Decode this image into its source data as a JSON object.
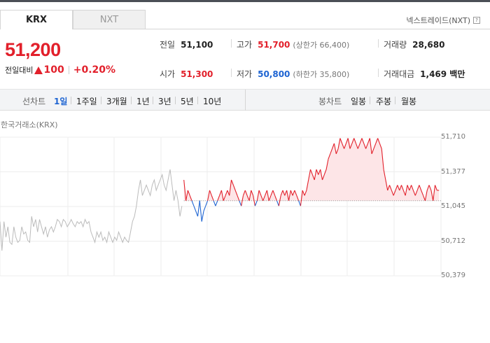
{
  "tabs": [
    {
      "label": "KRX",
      "active": true
    },
    {
      "label": "NXT",
      "active": false
    }
  ],
  "nxt_link": {
    "label": "넥스트레이드(NXT)",
    "icon": "question-icon"
  },
  "price": {
    "current": "51,200",
    "change_label": "전일대비",
    "change_value": "100",
    "change_percent": "+0.20%",
    "direction": "up",
    "up_color": "#e2202b",
    "down_color": "#1e64d2"
  },
  "stats": {
    "prev_close": {
      "label": "전일",
      "value": "51,100"
    },
    "high": {
      "label": "고가",
      "value": "51,700",
      "limit": "(상한가 66,400)"
    },
    "volume": {
      "label": "거래량",
      "value": "28,680"
    },
    "open": {
      "label": "시가",
      "value": "51,300"
    },
    "low": {
      "label": "저가",
      "value": "50,800",
      "limit": "(하한가 35,800)"
    },
    "amount": {
      "label": "거래대금",
      "value": "1,469 백만"
    }
  },
  "toolbar": {
    "line_label": "선차트",
    "line_periods": [
      "1일",
      "1주일",
      "3개월",
      "1년",
      "3년",
      "5년",
      "10년"
    ],
    "line_active": "1일",
    "candle_label": "봉차트",
    "candle_periods": [
      "일봉",
      "주봉",
      "월봉"
    ]
  },
  "chart_title": "한국거래소(KRX)",
  "chart_data": {
    "type": "line",
    "title": "한국거래소(KRX)",
    "ylim": [
      50379,
      51710
    ],
    "y_ticks": [
      "51,710",
      "51,377",
      "51,045",
      "50,712",
      "50,379"
    ],
    "baseline": 51100,
    "grid": true,
    "colors": {
      "before_open": "#bbbbbb",
      "above": "#e2202b",
      "below": "#1e64d2",
      "fill": "#fde5e7"
    },
    "pre_market": [
      50900,
      50620,
      50900,
      50750,
      50850,
      50700,
      50680,
      50850,
      50750,
      50700,
      50720,
      50850,
      50780,
      50800,
      50720,
      50700,
      50950,
      50850,
      50920,
      50800,
      50920,
      50850,
      50780,
      50850,
      50750,
      50820,
      50850,
      50800,
      50850,
      50920,
      50900,
      50850,
      50920,
      50900,
      50850,
      50880,
      50920,
      50880,
      50850,
      50900,
      50880,
      50900,
      50850,
      50920,
      50880,
      50900,
      50800,
      50750,
      50700,
      50800,
      50750,
      50800,
      50720,
      50750,
      50700,
      50800,
      50750,
      50700,
      50750,
      50720,
      50800,
      50750,
      50700,
      50750,
      50720,
      50700,
      50800,
      50900,
      50950,
      51050,
      51200,
      51300,
      51150,
      51200,
      51250,
      51200,
      51150,
      51250,
      51300,
      51200,
      51250,
      51300,
      51350,
      51250,
      51200,
      51300,
      51400,
      51250,
      51100,
      51200,
      51100,
      50950,
      51050
    ],
    "session": [
      51300,
      51100,
      51200,
      51150,
      51100,
      51050,
      51000,
      50950,
      51100,
      50900,
      51000,
      51050,
      51100,
      51200,
      51150,
      51100,
      51050,
      51100,
      51150,
      51200,
      51100,
      51150,
      51200,
      51150,
      51300,
      51250,
      51200,
      51150,
      51100,
      51050,
      51150,
      51200,
      51150,
      51100,
      51200,
      51150,
      51050,
      51100,
      51200,
      51150,
      51100,
      51150,
      51200,
      51100,
      51150,
      51200,
      51150,
      51100,
      51050,
      51150,
      51200,
      51150,
      51200,
      51100,
      51200,
      51150,
      51200,
      51150,
      51100,
      51050,
      51200,
      51150,
      51200,
      51300,
      51400,
      51350,
      51300,
      51400,
      51350,
      51400,
      51300,
      51350,
      51400,
      51500,
      51550,
      51600,
      51650,
      51550,
      51600,
      51700,
      51650,
      51600,
      51650,
      51700,
      51600,
      51650,
      51700,
      51650,
      51600,
      51650,
      51700,
      51650,
      51600,
      51650,
      51700,
      51550,
      51600,
      51650,
      51700,
      51650,
      51600,
      51400,
      51300,
      51200,
      51250,
      51200,
      51150,
      51200,
      51250,
      51200,
      51250,
      51200,
      51150,
      51250,
      51200,
      51250,
      51200,
      51150,
      51200,
      51250,
      51200,
      51150,
      51100,
      51200,
      51250,
      51200,
      51100,
      51250,
      51200,
      51200
    ]
  }
}
